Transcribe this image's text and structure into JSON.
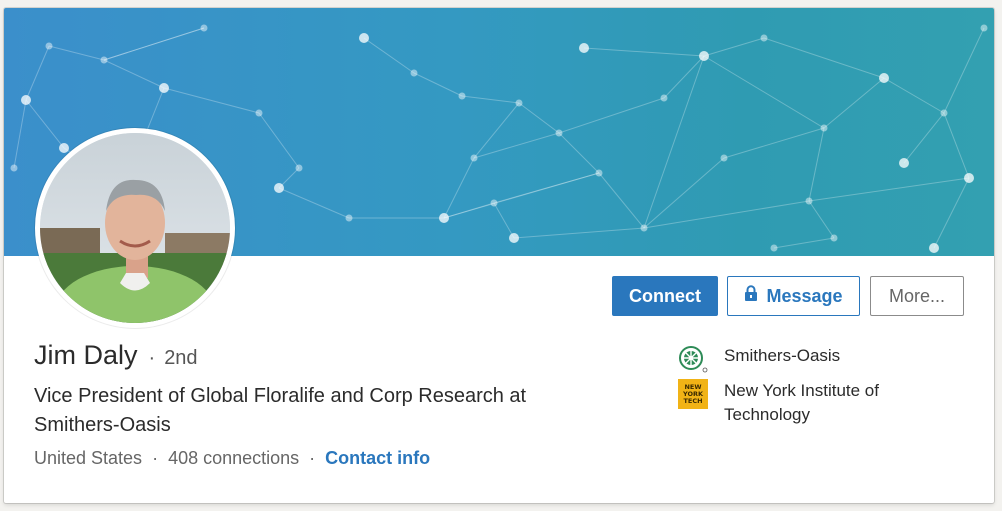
{
  "profile": {
    "name": "Jim Daly",
    "separator": "·",
    "degree": "2nd",
    "headline": "Vice President of Global Floralife and Corp Research at Smithers-Oasis",
    "location": "United States",
    "connections": "408 connections",
    "contact_info": "Contact info",
    "meta_separator": "·"
  },
  "actions": {
    "connect_label": "Connect",
    "message_label": "Message",
    "more_label": "More..."
  },
  "organizations": [
    {
      "name": "Smithers-Oasis",
      "logo": "smithers-oasis-logo"
    },
    {
      "name": "New York Institute of Technology",
      "logo": "nyit-logo",
      "logo_text": [
        "NEW",
        "YORK",
        "TECH"
      ]
    }
  ],
  "colors": {
    "accent": "#2a77bd",
    "banner_start": "#3b8fcb",
    "banner_end": "#33a0b1",
    "nyit_gold": "#f1b316",
    "smithers_green": "#2e8b57"
  }
}
